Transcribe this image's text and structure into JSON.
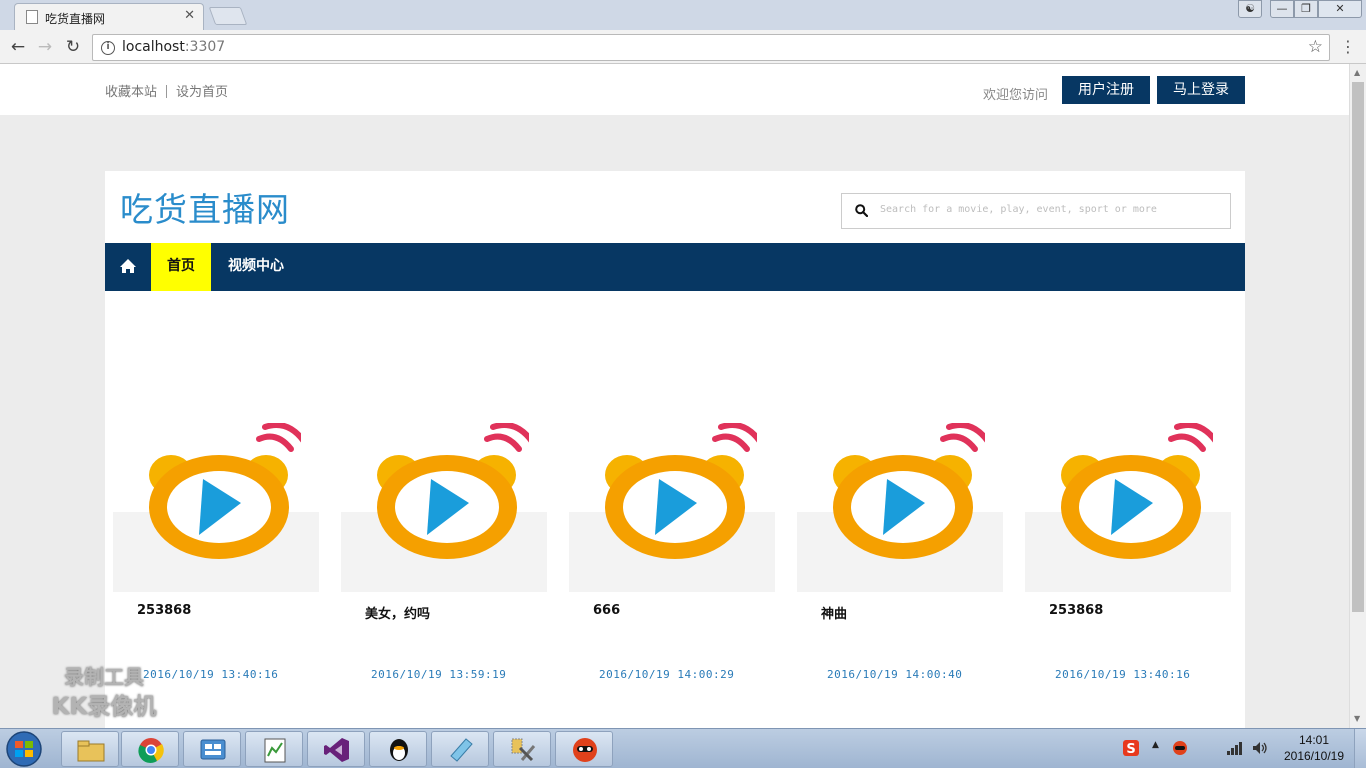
{
  "browser": {
    "tab_title": "吃货直播网",
    "tab_close": "✕",
    "url_host": "localhost",
    "url_port": ":3307"
  },
  "topbar": {
    "favorite_label": "收藏本站",
    "homepage_label": "设为首页",
    "welcome": "欢迎您访问",
    "register_label": "用户注册",
    "login_label": "马上登录"
  },
  "header": {
    "logo": "吃货直播网",
    "search_placeholder": "Search for a movie, play, event, sport or more"
  },
  "nav": {
    "home_label": "首页",
    "video_label": "视频中心"
  },
  "videos": [
    {
      "title": "253868",
      "date": "2016/10/19 13:40:16"
    },
    {
      "title": "美女，约吗",
      "date": "2016/10/19 13:59:19"
    },
    {
      "title": "666",
      "date": "2016/10/19 14:00:29"
    },
    {
      "title": "神曲",
      "date": "2016/10/19 14:00:40"
    },
    {
      "title": "253868",
      "date": "2016/10/19 13:40:16"
    }
  ],
  "watermark": {
    "line1": "录制工具",
    "line2": "KK录像机"
  },
  "clock": {
    "time": "14:01",
    "date": "2016/10/19"
  },
  "colors": {
    "nav_bg": "#073763",
    "active_nav": "#ffff00",
    "logo_blue": "#2a8ccb",
    "date_blue": "#2a7bb8"
  }
}
